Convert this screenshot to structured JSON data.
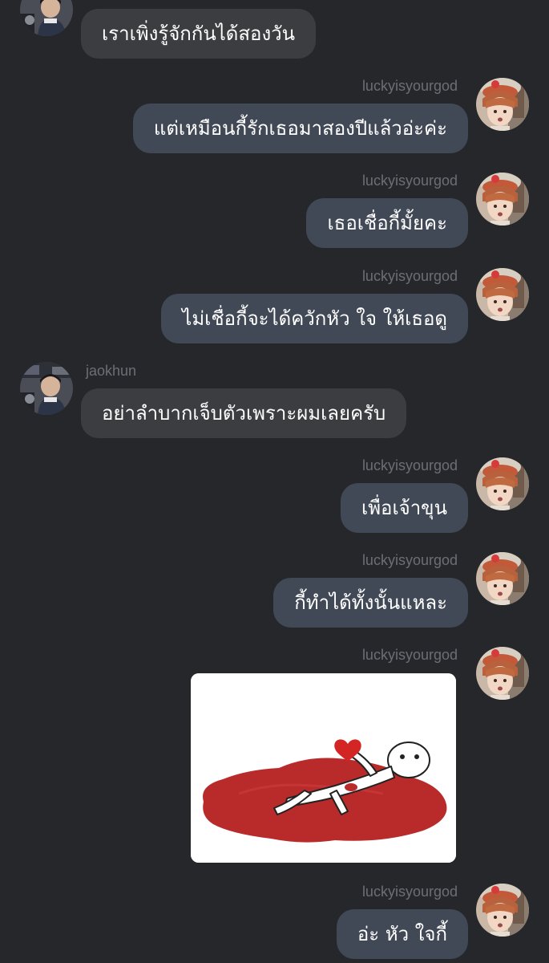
{
  "chat": {
    "messages": [
      {
        "side": "left",
        "sender": "",
        "text": "เราเพิ่งรู้จักกันได้สองวัน",
        "avatar": "jaokhun-avatar"
      },
      {
        "side": "right",
        "sender": "luckyisyourgod",
        "text": "แต่เหมือนกี้รักเธอมาสองปีแล้วอ่ะค่ะ",
        "avatar": "luckyisyourgod-avatar"
      },
      {
        "side": "right",
        "sender": "luckyisyourgod",
        "text": "เธอเชื่อกี้มั้ยคะ",
        "avatar": "luckyisyourgod-avatar"
      },
      {
        "side": "right",
        "sender": "luckyisyourgod",
        "text": "ไม่เชื่อกี้จะได้ควักหัว ใจ ให้เธอดู",
        "avatar": "luckyisyourgod-avatar"
      },
      {
        "side": "left",
        "sender": "jaokhun",
        "text": "อย่าลำบากเจ็บตัวเพราะผมเลยครับ",
        "avatar": "jaokhun-avatar"
      },
      {
        "side": "right",
        "sender": "luckyisyourgod",
        "text": "เพื่อเจ้าขุน",
        "avatar": "luckyisyourgod-avatar"
      },
      {
        "side": "right",
        "sender": "luckyisyourgod",
        "text": "กี้ทำได้ทั้งนั้นแหละ",
        "avatar": "luckyisyourgod-avatar"
      },
      {
        "side": "right",
        "sender": "luckyisyourgod",
        "type": "image",
        "image": "sticker-heart-blood",
        "avatar": "luckyisyourgod-avatar"
      },
      {
        "side": "right",
        "sender": "luckyisyourgod",
        "text": "อ่ะ หัว ใจกี้",
        "avatar": "luckyisyourgod-avatar"
      }
    ]
  },
  "colors": {
    "background": "#26272b",
    "bubble_right": "#414856",
    "bubble_left": "#3c3d41",
    "sender_name": "#6b6e76",
    "text": "#ffffff",
    "blood": "#b92a2a"
  }
}
